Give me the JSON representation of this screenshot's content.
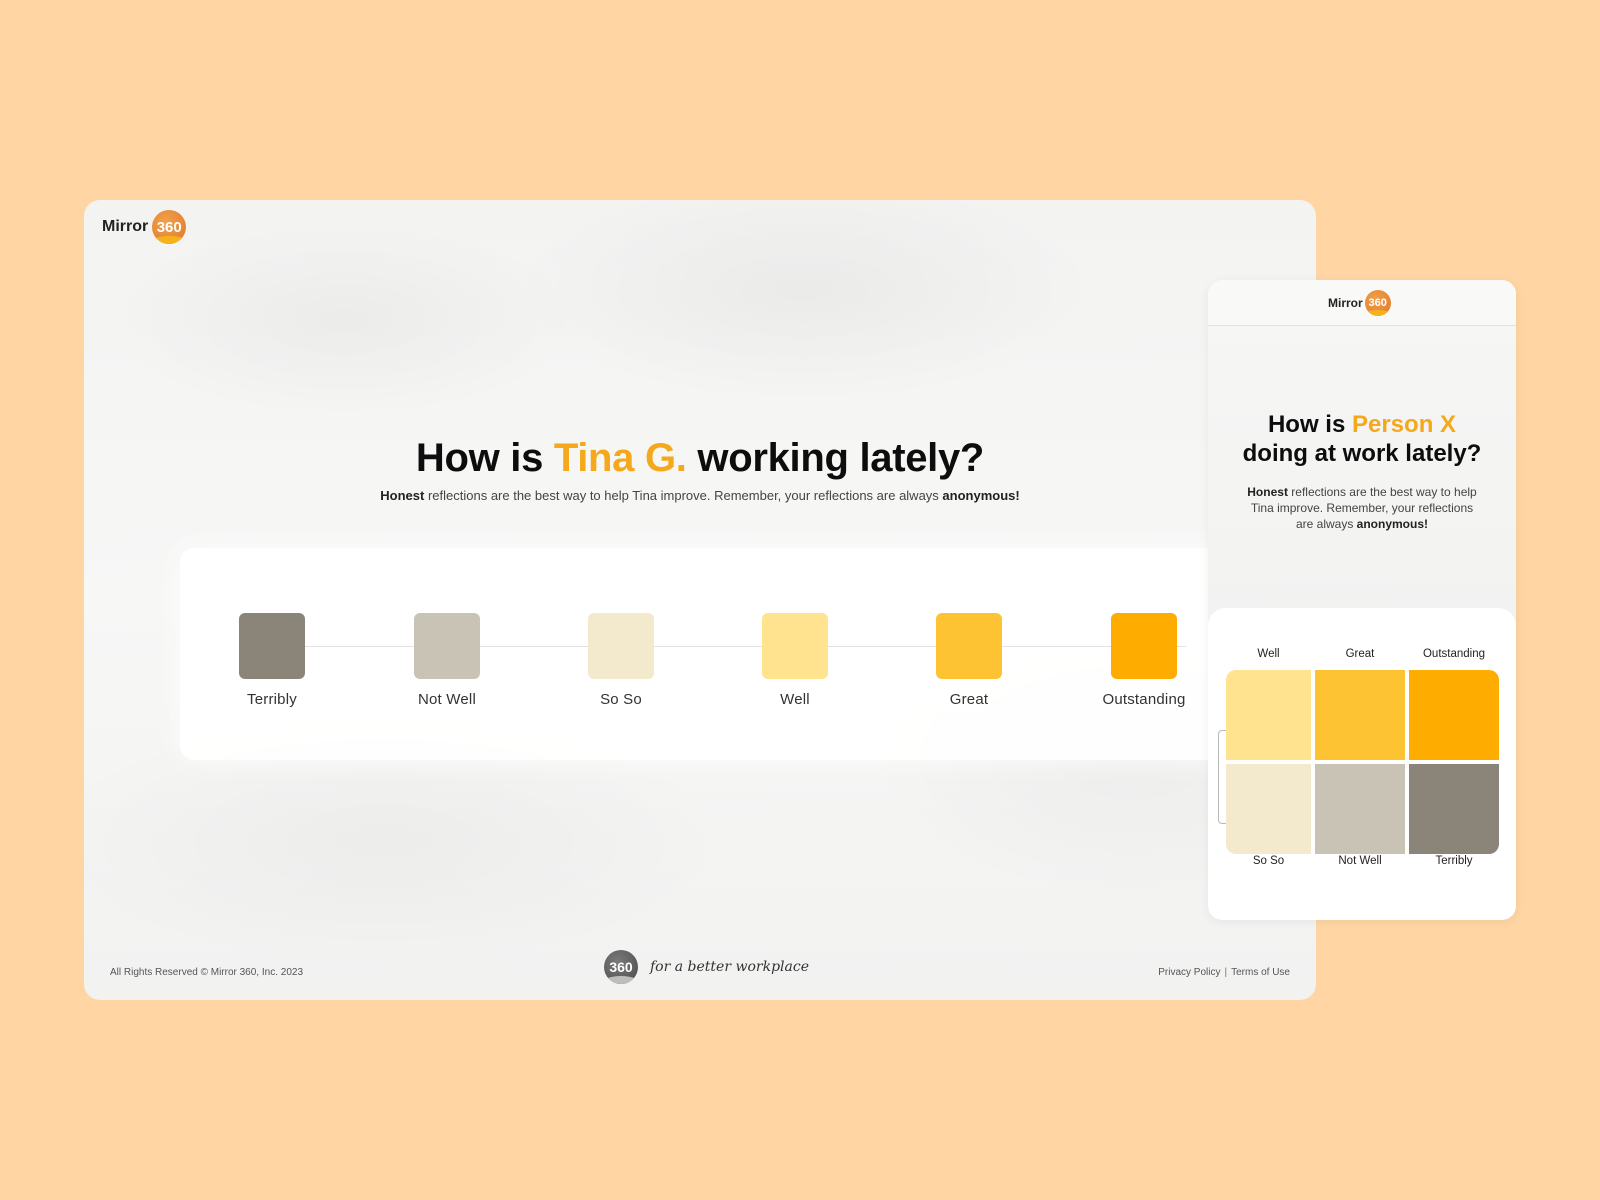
{
  "brand": {
    "name": "Mirror",
    "badge": "360",
    "orange": "#E0782A",
    "yellow": "#F6B21B"
  },
  "desktop": {
    "headline": {
      "prefix": "How is ",
      "name": "Tina G.",
      "suffix": " working lately?"
    },
    "subtitle": {
      "lead": "Honest",
      "middle": " reflections are the best way to help Tina improve. Remember, your reflections are always ",
      "end": "anonymous!"
    },
    "ratings": [
      {
        "label": "Terribly",
        "color": "#8A8578"
      },
      {
        "label": "Not Well",
        "color": "#C8C3B5"
      },
      {
        "label": "So So",
        "color": "#F3E9CC"
      },
      {
        "label": "Well",
        "color": "#FFE38F"
      },
      {
        "label": "Great",
        "color": "#FDC332"
      },
      {
        "label": "Outstanding",
        "color": "#FFAC00"
      }
    ],
    "footer": {
      "copyright": "All Rights Reserved © Mirror 360, Inc. 2023",
      "badge": "360",
      "tagline": "for a better workplace",
      "privacy": "Privacy Policy",
      "separator": "|",
      "terms": "Terms of Use"
    }
  },
  "mobile": {
    "headline": {
      "prefix": "How is ",
      "name": "Person X",
      "line2": "doing at work lately?"
    },
    "subtitle": {
      "lead": "Honest",
      "middle": " reflections are the best way to help Tina improve. Remember, your reflections are always ",
      "end": "anonymous!"
    },
    "top_labels": [
      "Well",
      "Great",
      "Outstanding"
    ],
    "bottom_labels": [
      "So So",
      "Not Well",
      "Terribly"
    ],
    "grid_colors": [
      "#FFE38F",
      "#FDC332",
      "#FFAC00",
      "#F3E9CC",
      "#C8C3B5",
      "#8A8578"
    ]
  }
}
